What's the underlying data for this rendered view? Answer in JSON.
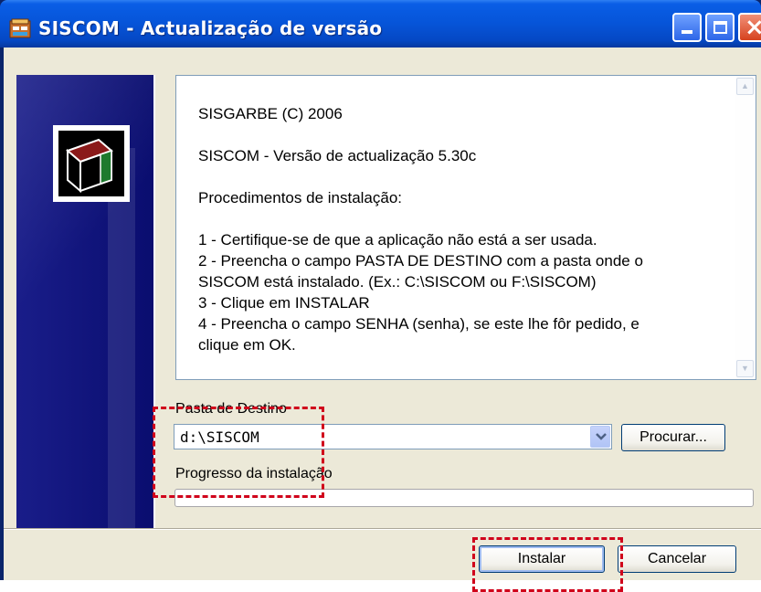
{
  "window": {
    "title": "SISCOM - Actualização de versão",
    "app_icon": "installer-icon",
    "controls": [
      "minimize",
      "maximize",
      "close"
    ]
  },
  "info_text": {
    "lines": [
      "SISGARBE (C) 2006",
      "",
      "SISCOM - Versão de actualização 5.30c",
      "",
      "Procedimentos de instalação:",
      "",
      "1 - Certifique-se de que a aplicação não está a ser usada.",
      "2 - Preencha o campo PASTA DE DESTINO com a pasta onde o",
      "SISCOM está instalado. (Ex.: C:\\SISCOM ou F:\\SISCOM)",
      "3 - Clique em INSTALAR",
      "4 - Preencha o campo SENHA (senha), se este lhe fôr pedido, e",
      "clique em OK."
    ]
  },
  "destination": {
    "label": "Pasta de Destino",
    "value": "d:\\SISCOM",
    "browse_label": "Procurar..."
  },
  "progress": {
    "label": "Progresso da instalação",
    "fraction": 0
  },
  "footer": {
    "install_label": "Instalar",
    "cancel_label": "Cancelar"
  },
  "colors": {
    "title_bar": "#0654d8",
    "banner": "#0b0f82",
    "dialog_bg": "#ece9d8",
    "highlight_annotation": "#d0021b"
  }
}
